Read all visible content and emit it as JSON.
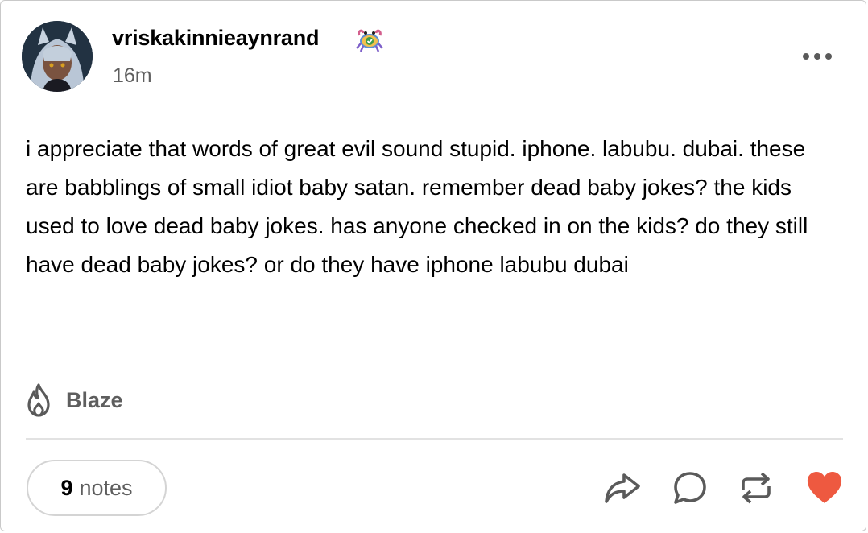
{
  "post": {
    "username": "vriskakinnieaynrand",
    "timestamp": "16m",
    "body": "i appreciate that words of great evil sound stupid. iphone. labubu. dubai. these are babblings of small idiot baby satan. remember dead baby jokes? the kids used to love dead baby jokes. has anyone checked in on the kids? do they still have dead baby jokes? or do they have iphone labubu dubai",
    "blaze_label": "Blaze",
    "notes_count": "9",
    "notes_label": "notes",
    "liked": true
  },
  "icons": {
    "avatar": "avatar-image",
    "badge": "crab-badge-icon",
    "more": "more-options-icon",
    "blaze": "flame-icon",
    "share": "share-arrow-icon",
    "reply": "reply-bubble-icon",
    "reblog": "reblog-icon",
    "like": "heart-icon"
  },
  "colors": {
    "heart": "#ee5940",
    "muted_text": "#5e5e5e",
    "icon_gray": "#5a5a5a",
    "divider": "#e2e2e2"
  }
}
